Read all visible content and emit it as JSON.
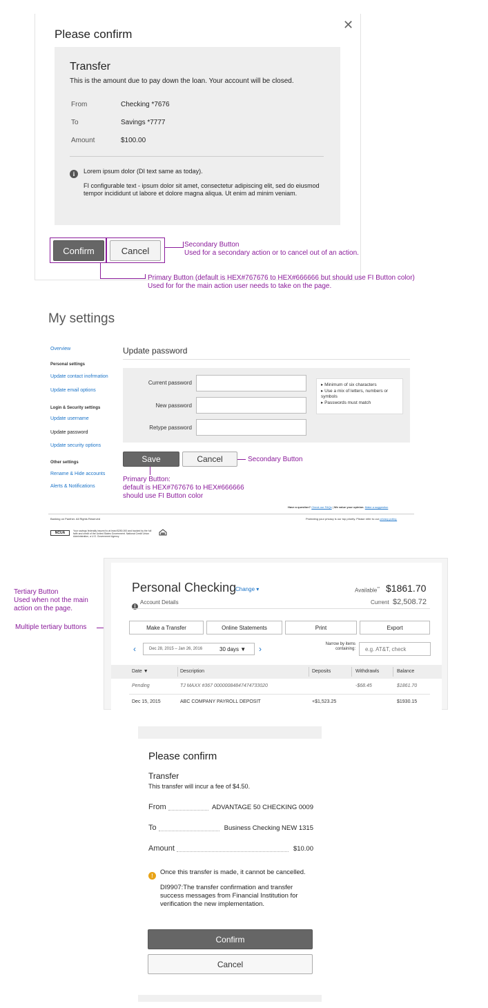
{
  "confirm_modal": {
    "title": "Please confirm",
    "close_glyph": "✕",
    "transfer_title": "Transfer",
    "transfer_desc": "This is the amount due to pay down the loan. Your account will be closed.",
    "rows": [
      {
        "label": "From",
        "value": "Checking *7676"
      },
      {
        "label": "To",
        "value": "Savings *7777"
      },
      {
        "label": "Amount",
        "value": "$100.00"
      }
    ],
    "info_title": "Lorem ipsum dolor (DI text same as today).",
    "info_body": "FI configurable text  - ipsum dolor sit amet, consectetur adipiscing elit, sed do eiusmod tempor incididunt ut labore et dolore magna aliqua. Ut enim ad minim veniam.",
    "confirm_label": "Confirm",
    "cancel_label": "Cancel"
  },
  "annotations": {
    "secondary_title": "Secondary Button",
    "secondary_desc": "Used for a secondary action or to cancel out of an action.",
    "primary_title": "Primary Button (default is HEX#767676 to HEX#666666  but should use FI Button color)",
    "primary_desc": "Used for for the main action user needs to take on the page.",
    "secondary_short": "Secondary Button",
    "primary2_title": "Primary Button:",
    "primary2_line2": "default is HEX#767676 to HEX#666666",
    "primary2_line3": "should use FI Button color",
    "tertiary_title": "Tertiary Button",
    "tertiary_desc1": "Used when not the main",
    "tertiary_desc2": "action on the page.",
    "multiple_tertiary": "Multiple tertiary buttons"
  },
  "settings": {
    "title": "My settings",
    "sidebar": [
      {
        "label": "Overview",
        "kind": "link"
      },
      {
        "label": "Personal settings",
        "kind": "heading"
      },
      {
        "label": "Update contact inofrmation",
        "kind": "link"
      },
      {
        "label": "Update email options",
        "kind": "link"
      },
      {
        "label": "Login & Security settings",
        "kind": "heading"
      },
      {
        "label": "Update username",
        "kind": "link"
      },
      {
        "label": "Update password",
        "kind": "active"
      },
      {
        "label": "Update security options",
        "kind": "link"
      },
      {
        "label": "Other settings",
        "kind": "heading"
      },
      {
        "label": "Rename & Hide accounts",
        "kind": "link"
      },
      {
        "label": "Alerts & Notifications",
        "kind": "link"
      }
    ],
    "section_title": "Update password",
    "fields": [
      {
        "label": "Current password",
        "value": ""
      },
      {
        "label": "New password",
        "value": ""
      },
      {
        "label": "Retype password",
        "value": ""
      }
    ],
    "tips": [
      "Minimum of six characters",
      "Use a mix of letters, numbers or symbols",
      "Passwords must match"
    ],
    "save_label": "Save",
    "cancel_label": "Cancel",
    "help_q": "Have a question?",
    "help_link": "Check our FAQs",
    "help_sep": "|",
    "opinion": "We value your opinion.",
    "opinion_link": "Make a suggestion",
    "copyright": "Banking on Panther. All Rights Reserved",
    "privacy": "Protecting your privacy is our top priority. Please refer to our",
    "privacy_link": "privacy policy.",
    "ncua": "NCUA",
    "ncua_text": "Your savings federally insured to at least $250,000 and backed by the full faith and credit of the United States Government. National Credit Union Administration, a U.S. Government Agency",
    "ehl_text": "EQUAL HOUSING LENDER"
  },
  "account": {
    "name": "Personal Checking",
    "change_label": "Change ▾",
    "details_label": "Account Details",
    "available_label": "Available",
    "available_sup": "**",
    "available_value": "$1861.70",
    "current_label": "Current",
    "current_value": "$2,508.72",
    "actions": [
      "Make a Transfer",
      "Online Statements",
      "Print",
      "Export"
    ],
    "date_range": "Dec 28, 2015 – Jan 26, 2016",
    "days": "30 days ▼",
    "narrow_label": "Narrow by items containing:",
    "search_placeholder": "e.g. AT&T, check",
    "columns": [
      "Date ▼",
      "Description",
      "Deposits",
      "Withdrawls",
      "Balance"
    ],
    "rows": [
      {
        "date": "Pending",
        "desc": "TJ MAXX #367 00000084847474733020",
        "deposit": "",
        "withdraw": "-$68.45",
        "balance": "$1861.70",
        "pending": true
      },
      {
        "date": "Dec 15, 2015",
        "desc": "ABC COMPANY PAYROLL DEPOSIT",
        "deposit": "+$1,523.25",
        "withdraw": "",
        "balance": "$1930.15",
        "pending": false
      }
    ]
  },
  "confirm_mobile": {
    "title": "Please confirm",
    "transfer_title": "Transfer",
    "fee_text": "This transfer will incur a fee of $4.50.",
    "rows": [
      {
        "label": "From",
        "value": "ADVANTAGE 50 CHECKING 0009"
      },
      {
        "label": "To",
        "value": "Business Checking NEW 1315"
      },
      {
        "label": "Amount",
        "value": "$10.00"
      }
    ],
    "warning": "Once this transfer is made, it cannot be cancelled.",
    "note": "DI9907:The transfer confirmation and transfer success messages from Financial Institution for verification the new implementation.",
    "confirm_label": "Confirm",
    "cancel_label": "Cancel"
  }
}
